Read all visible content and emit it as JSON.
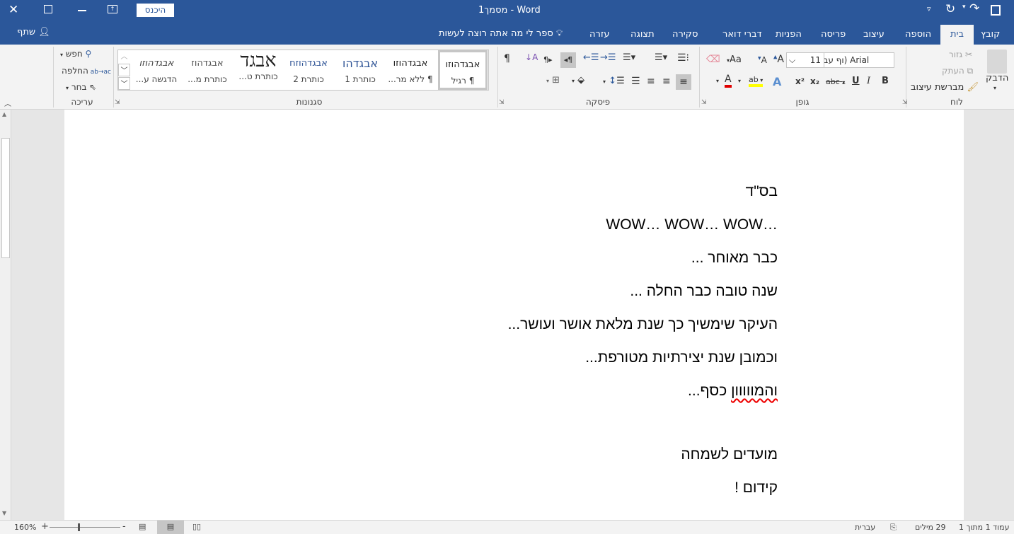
{
  "window": {
    "title": "מסמך1 - Word",
    "signin": "היכנס",
    "share": "שתף"
  },
  "tabs": [
    "קובץ",
    "בית",
    "הוספה",
    "עיצוב",
    "פריסה",
    "הפניות",
    "דברי דואר",
    "סקירה",
    "תצוגה",
    "עזרה"
  ],
  "tell_me": "ספר לי מה אתה רוצה לעשות",
  "clipboard": {
    "label": "לוח",
    "paste": "הדבק",
    "cut": "גזור",
    "copy": "העתק",
    "format_painter": "מברשת עיצוב"
  },
  "font": {
    "label": "גופן",
    "name": "Arial (גוף עברי)",
    "name_visible": "וף עברי) Arial",
    "size": "11",
    "bold": "B",
    "italic": "I",
    "underline": "U",
    "strike": "abc",
    "sub": "x₂",
    "sup": "x²",
    "case": "Aa"
  },
  "paragraph": {
    "label": "פיסקה",
    "pilcrow": "¶"
  },
  "styles": {
    "label": "סגנונות",
    "items": [
      {
        "preview": "אבגדהוזו",
        "name": "¶ רגיל"
      },
      {
        "preview": "אבגדהוזו",
        "name": "¶ ללא מר..."
      },
      {
        "preview": "אבגדהו",
        "name": "כותרת 1"
      },
      {
        "preview": "אבגדהוזח",
        "name": "כותרת 2"
      },
      {
        "preview": "אבגד",
        "name": "כותרת ט..."
      },
      {
        "preview": "אבגדהוז",
        "name": "כותרת מ..."
      },
      {
        "preview": "אבגדהוזו",
        "name": "הדגשה ע..."
      }
    ]
  },
  "editing": {
    "label": "עריכה",
    "find": "חפש",
    "replace": "החלפה",
    "select": "בחר"
  },
  "document": {
    "lines": [
      "בס\"ד",
      "WOW… WOW… WOW…",
      "כבר מאוחר ...",
      "שנה טובה כבר החלה ...",
      "העיקר שימשיך כך שנת מלאת אושר ועושר...",
      "וכמובן שנת יצירתיות מטורפת...",
      "והמווווון כסף...",
      "",
      "מועדים לשמחה",
      "קידום !"
    ],
    "misspelled": "והמווווון"
  },
  "status": {
    "page": "עמוד 1 מתוך 1",
    "words": "29 מילים",
    "language": "עברית",
    "zoom": "160%",
    "zoom_level": 160
  },
  "colors": {
    "accent": "#2b579a",
    "font_color": "#e00000",
    "highlight": "#ffff00"
  }
}
